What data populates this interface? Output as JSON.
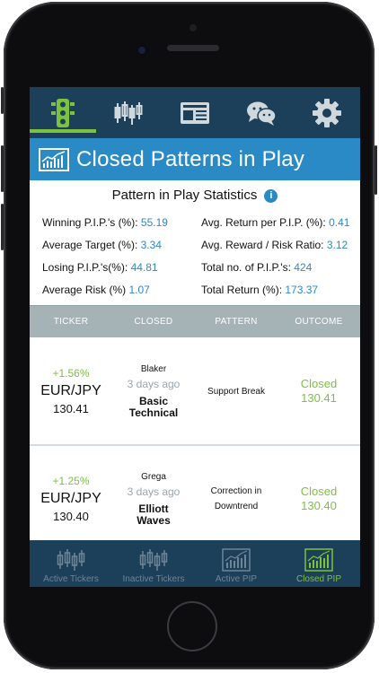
{
  "header": {
    "title": "Closed Patterns in Play"
  },
  "top_nav": [
    {
      "icon": "traffic-light-icon",
      "active": true
    },
    {
      "icon": "candlestick-icon",
      "active": false
    },
    {
      "icon": "newspaper-icon",
      "active": false
    },
    {
      "icon": "chat-bubbles-icon",
      "active": false
    },
    {
      "icon": "gear-icon",
      "active": false
    }
  ],
  "stats": {
    "title": "Pattern in Play Statistics",
    "winning": {
      "label": "Winning P.I.P.'s (%):",
      "value": "55.19"
    },
    "avg_return": {
      "label": "Avg. Return per P.I.P. (%):",
      "value": "0.41"
    },
    "avg_target": {
      "label": "Average Target (%):",
      "value": "3.34"
    },
    "avg_reward_risk": {
      "label": "Avg. Reward / Risk Ratio:",
      "value": "3.12"
    },
    "losing": {
      "label": "Losing P.I.P.'s(%):",
      "value": "44.81"
    },
    "total_pips": {
      "label": "Total no. of P.I.P.'s:",
      "value": "424"
    },
    "avg_risk": {
      "label": "Average Risk (%)",
      "value": "1.07"
    },
    "total_return": {
      "label": "Total Return (%):",
      "value": "173.37"
    }
  },
  "table": {
    "headers": {
      "ticker": "TICKER",
      "closed": "CLOSED",
      "pattern": "PATTERN",
      "outcome": "OUTCOME"
    },
    "rows": [
      {
        "change": "+1.56%",
        "pair": "EUR/JPY",
        "price": "130.41",
        "user": "Blaker",
        "ago": "3 days ago",
        "method1": "Basic",
        "method2": "Technical",
        "pattern1": "Support Break",
        "pattern2": "",
        "outcome_status": "Closed",
        "outcome_price": "130.41"
      },
      {
        "change": "+1.25%",
        "pair": "EUR/JPY",
        "price": "130.40",
        "user": "Grega",
        "ago": "3 days ago",
        "method1": "Elliott",
        "method2": "Waves",
        "pattern1": "Correction in",
        "pattern2": "Downtrend",
        "outcome_status": "Closed",
        "outcome_price": "130.40"
      }
    ]
  },
  "bottom_nav": [
    {
      "label": "Active Tickers",
      "icon": "candlestick-chart-icon",
      "active": false
    },
    {
      "label": "Inactive Tickers",
      "icon": "candlestick-chart-icon",
      "active": false
    },
    {
      "label": "Active PIP",
      "icon": "bar-chart-icon",
      "active": false
    },
    {
      "label": "Closed PIP",
      "icon": "bar-chart-icon",
      "active": true
    }
  ],
  "colors": {
    "nav_bg": "#1c3f5a",
    "title_bar": "#2a8ac6",
    "accent_green": "#7cc23f",
    "value_blue": "#2a8ac6",
    "table_header": "#a5b3b6"
  }
}
